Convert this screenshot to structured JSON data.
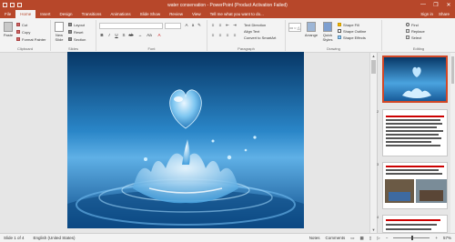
{
  "window": {
    "title": "water conservation - PowerPoint (Product Activation Failed)",
    "controls": [
      "—",
      "❐",
      "✕"
    ]
  },
  "tabs": [
    "File",
    "Home",
    "Insert",
    "Design",
    "Transitions",
    "Animations",
    "Slide Show",
    "Review",
    "View",
    "Tell me what you want to do..."
  ],
  "tabs_right": {
    "signin": "Sign in",
    "share": "Share"
  },
  "ribbon": {
    "clipboard": {
      "label": "Clipboard",
      "paste": "Paste",
      "cut": "Cut",
      "copy": "Copy",
      "format_painter": "Format Painter"
    },
    "slides": {
      "label": "Slides",
      "new_slide": "New Slide",
      "layout": "Layout",
      "reset": "Reset",
      "section": "Section"
    },
    "font": {
      "label": "Font",
      "font_name": "",
      "font_size": ""
    },
    "paragraph": {
      "label": "Paragraph",
      "text_direction": "Text Direction",
      "align_text": "Align Text",
      "convert": "Convert to SmartArt"
    },
    "drawing": {
      "label": "Drawing",
      "arrange": "Arrange",
      "quick_styles": "Quick Styles",
      "shape_fill": "Shape Fill",
      "shape_outline": "Shape Outline",
      "shape_effects": "Shape Effects"
    },
    "editing": {
      "label": "Editing",
      "find": "Find",
      "replace": "Replace",
      "select": "Select"
    }
  },
  "slides_pane": {
    "numbers": [
      "1",
      "2",
      "3",
      "4"
    ]
  },
  "status": {
    "slide_info": "Slide 1 of 4",
    "language": "English (United States)",
    "notes": "Notes",
    "comments": "Comments",
    "zoom": "57%"
  },
  "colors": {
    "accent": "#b7472a",
    "selected_border": "#d24726"
  }
}
